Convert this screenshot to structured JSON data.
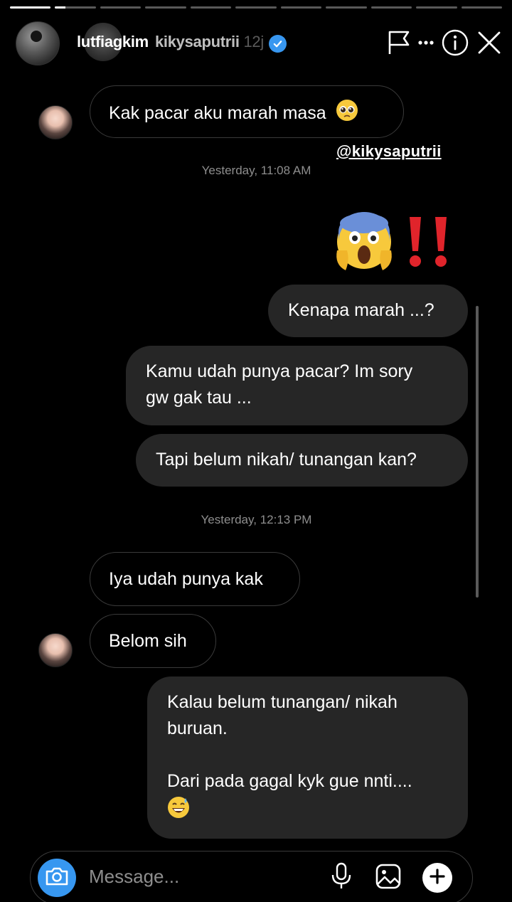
{
  "story": {
    "progress": [
      1,
      0.25,
      0,
      0,
      0,
      0,
      0,
      0,
      0,
      0,
      0
    ],
    "username": "lutfiagkim",
    "overlay_username": "kikysaputrii",
    "overlay_time": "12j",
    "icons": [
      "flag-icon",
      "more-icon",
      "info-icon",
      "close-icon"
    ]
  },
  "watermark": "@kikysaputrii",
  "chat": {
    "messages": [
      {
        "side": "in",
        "text": "Kak pacar aku marah masa",
        "emoji": "pleading-face"
      },
      {
        "timestamp": "Yesterday, 11:08 AM"
      },
      {
        "side": "reaction",
        "emoji": [
          "scream-face",
          "double-exclamation"
        ]
      },
      {
        "side": "out",
        "text": "Kenapa marah ...?"
      },
      {
        "side": "out",
        "line1": "Kamu udah punya pacar? Im sory",
        "line2": "gw gak tau ..."
      },
      {
        "side": "out",
        "text": "Tapi belum nikah/ tunangan kan?"
      },
      {
        "timestamp": "Yesterday, 12:13 PM"
      },
      {
        "side": "in",
        "text": "Iya udah punya kak"
      },
      {
        "side": "in",
        "text": "Belom sih"
      },
      {
        "side": "out",
        "line1": "Kalau belum tunangan/ nikah",
        "line2": "buruan.",
        "line3": "Dari pada gagal kyk gue nnti....",
        "emoji": "grinning-sweat-face"
      }
    ]
  },
  "composer": {
    "placeholder": "Message..."
  },
  "colors": {
    "accent": "#3797f0",
    "bubble_out": "#262626",
    "timestamp": "#8e8e8e"
  }
}
